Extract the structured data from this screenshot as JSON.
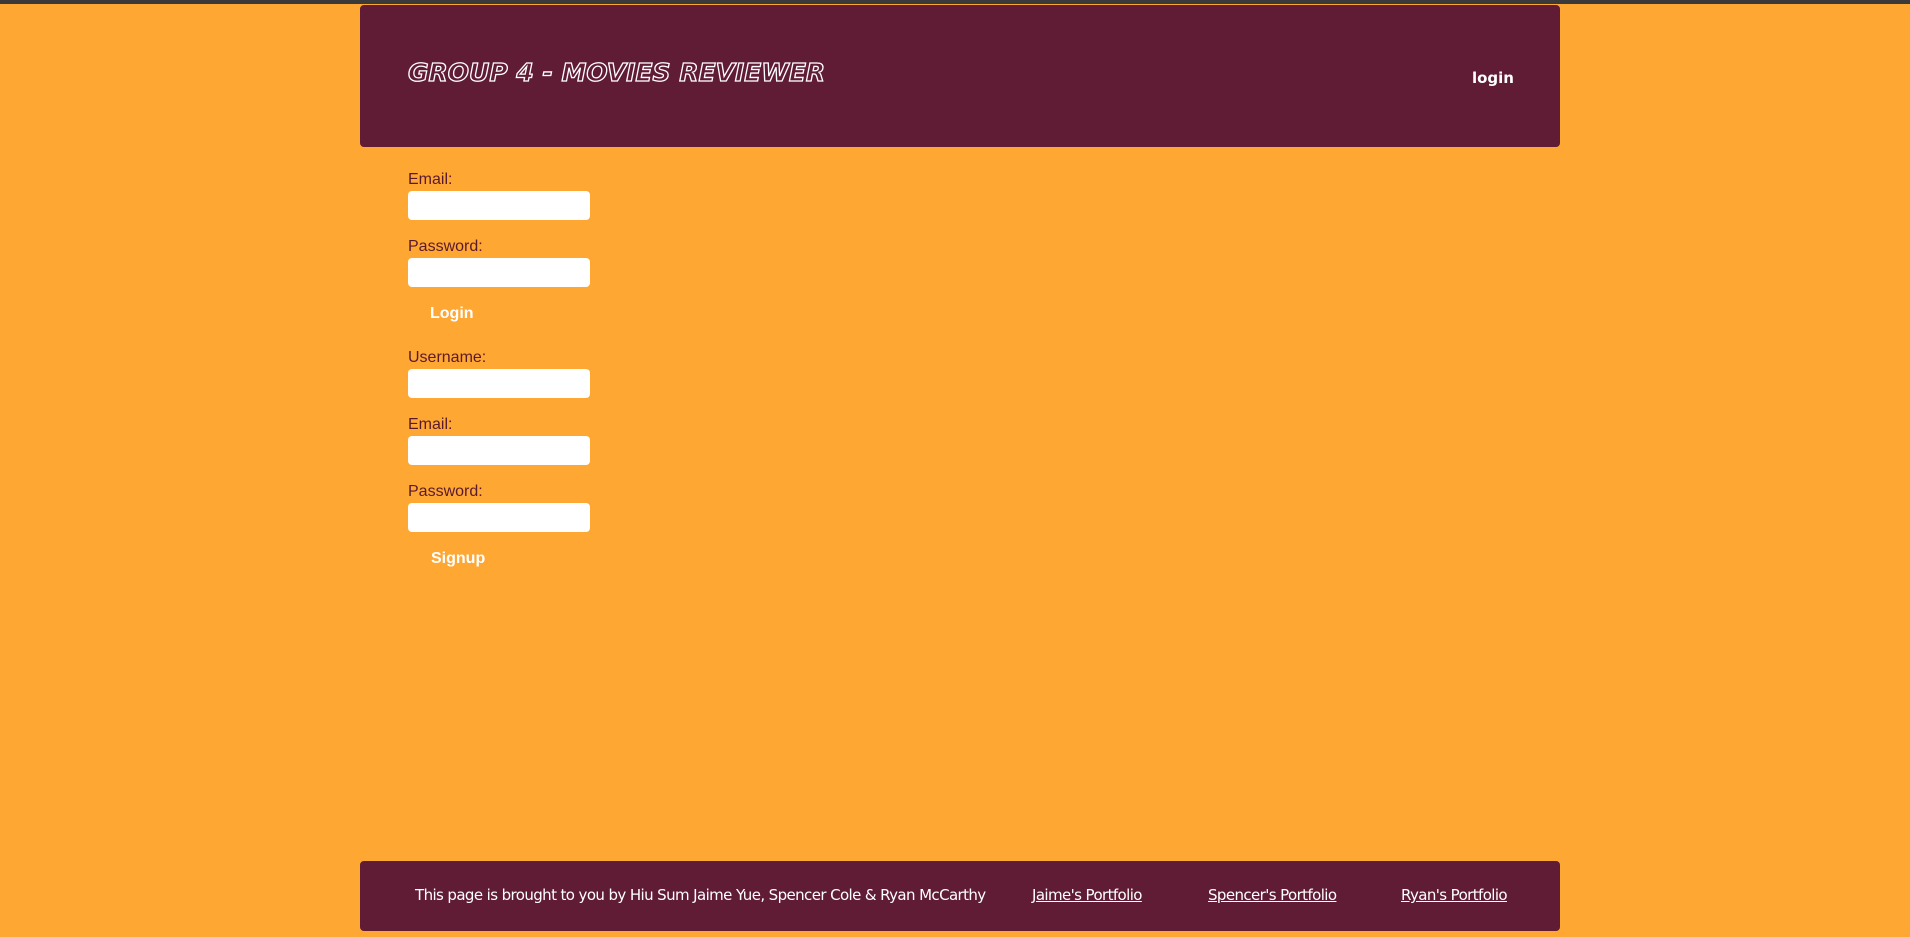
{
  "header": {
    "title": "GROUP 4 - MOVIES REVIEWER",
    "login_link": "login"
  },
  "login_form": {
    "email_label": "Email:",
    "email_value": "",
    "password_label": "Password:",
    "password_value": "",
    "submit_label": "Login"
  },
  "signup_form": {
    "username_label": "Username:",
    "username_value": "",
    "email_label": "Email:",
    "email_value": "",
    "password_label": "Password:",
    "password_value": "",
    "submit_label": "Signup"
  },
  "footer": {
    "credit_text": "This page is brought to you by Hiu Sum Jaime Yue, Spencer Cole & Ryan McCarthy",
    "links": [
      {
        "label": "Jaime's Portfolio"
      },
      {
        "label": "Spencer's Portfolio"
      },
      {
        "label": "Ryan's Portfolio"
      }
    ]
  },
  "colors": {
    "background": "#ffa733",
    "header_footer": "#611c35",
    "label_text": "#5a1a2e",
    "button_text": "#ffffff"
  }
}
